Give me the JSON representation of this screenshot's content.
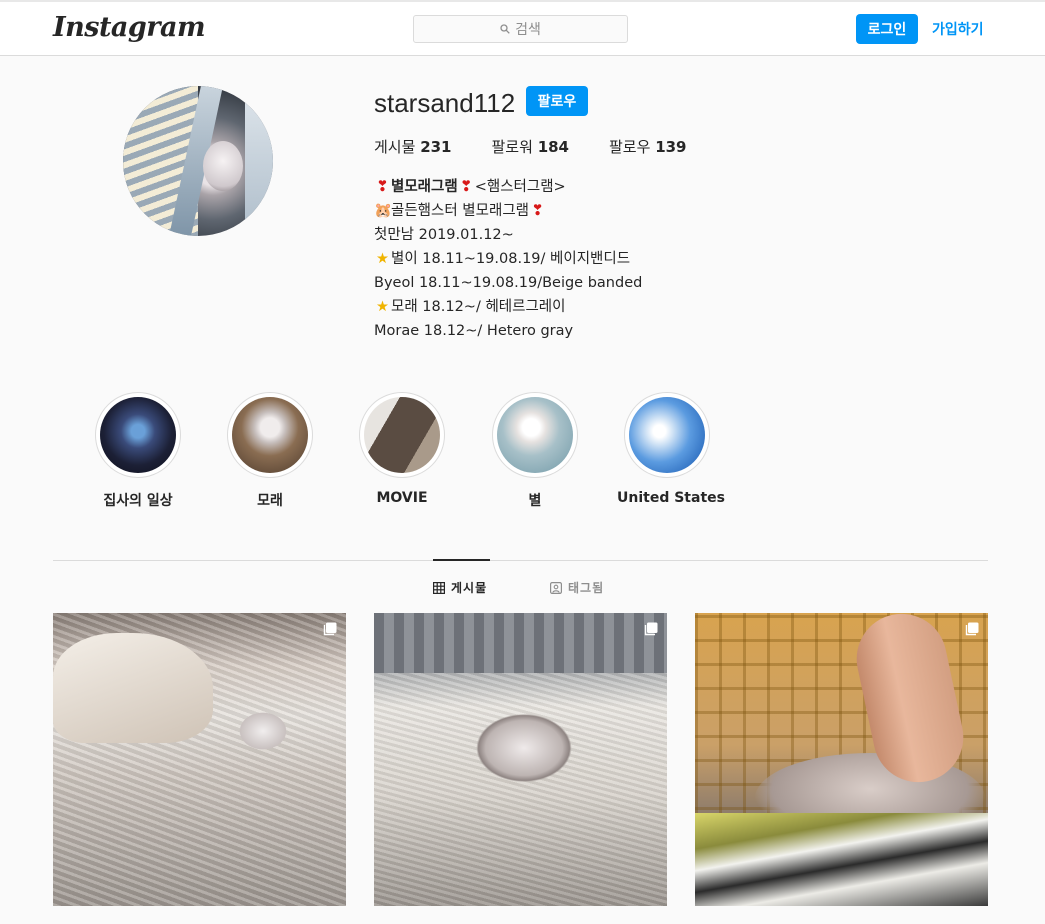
{
  "header": {
    "logo": "Instagram",
    "search_placeholder": "검색",
    "login_label": "로그인",
    "signup_label": "가입하기"
  },
  "profile": {
    "username": "starsand112",
    "follow_label": "팔로우",
    "stats": [
      {
        "label": "게시물",
        "value": "231"
      },
      {
        "label": "팔로워",
        "value": "184"
      },
      {
        "label": "팔로우",
        "value": "139"
      }
    ],
    "bio": {
      "name": "별모래그램",
      "name_suffix": "<햄스터그램>",
      "line1": "골든햄스터 별모래그램",
      "line2": "첫만남 2019.01.12~",
      "line3": "별이 18.11~19.08.19/ 베이지밴디드",
      "line4": "Byeol 18.11~19.08.19/Beige banded",
      "line5": "모래 18.12~/ 헤테르그레이",
      "line6": "Morae 18.12~/ Hetero gray"
    }
  },
  "highlights": [
    {
      "label": "집사의 일상"
    },
    {
      "label": "모래"
    },
    {
      "label": "MOVIE"
    },
    {
      "label": "별"
    },
    {
      "label": "United States"
    }
  ],
  "tabs": {
    "posts": "게시물",
    "tagged": "태그됨"
  },
  "colors": {
    "accent": "#0095f6",
    "text": "#262626",
    "muted": "#8e8e8e",
    "border": "#dbdbdb",
    "background": "#fafafa"
  },
  "icons": [
    "search-icon",
    "grid-icon",
    "tag-person-icon",
    "multi-post-icon",
    "heart-emoji-icon",
    "hamster-emoji-icon",
    "star-emoji-icon"
  ]
}
